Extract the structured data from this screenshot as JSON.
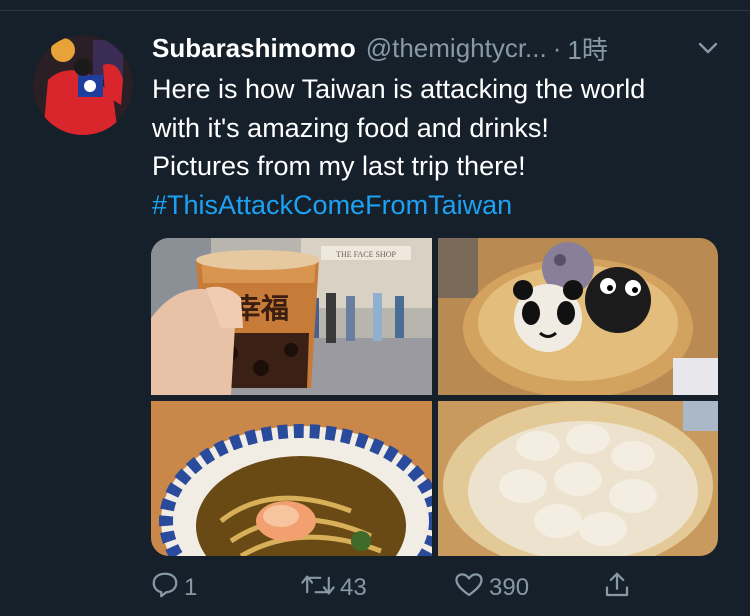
{
  "tweet": {
    "display_name": "Subarashimomo",
    "handle": "@themightycr...",
    "separator": "·",
    "time": "1時",
    "text_lines": [
      "Here is how Taiwan is attacking the world",
      "with it's amazing food and drinks!",
      "Pictures from my last trip there!"
    ],
    "hashtag": "#ThisAttackComeFromTaiwan"
  },
  "images": [
    {
      "alt": "bubble tea cup held in hand on a street",
      "sign": "THE FACE SHOP"
    },
    {
      "alt": "panda and black character buns in a bamboo steamer"
    },
    {
      "alt": "bowl of noodle soup with shrimp"
    },
    {
      "alt": "soup dumplings in a bamboo steamer"
    }
  ],
  "actions": {
    "reply_count": "1",
    "retweet_count": "43",
    "like_count": "390"
  },
  "icons": [
    "chevron-down-icon",
    "reply-icon",
    "retweet-icon",
    "like-icon",
    "share-icon"
  ],
  "colors": {
    "background": "#15202b",
    "secondary": "#8899a6",
    "accent": "#1da1f2"
  }
}
